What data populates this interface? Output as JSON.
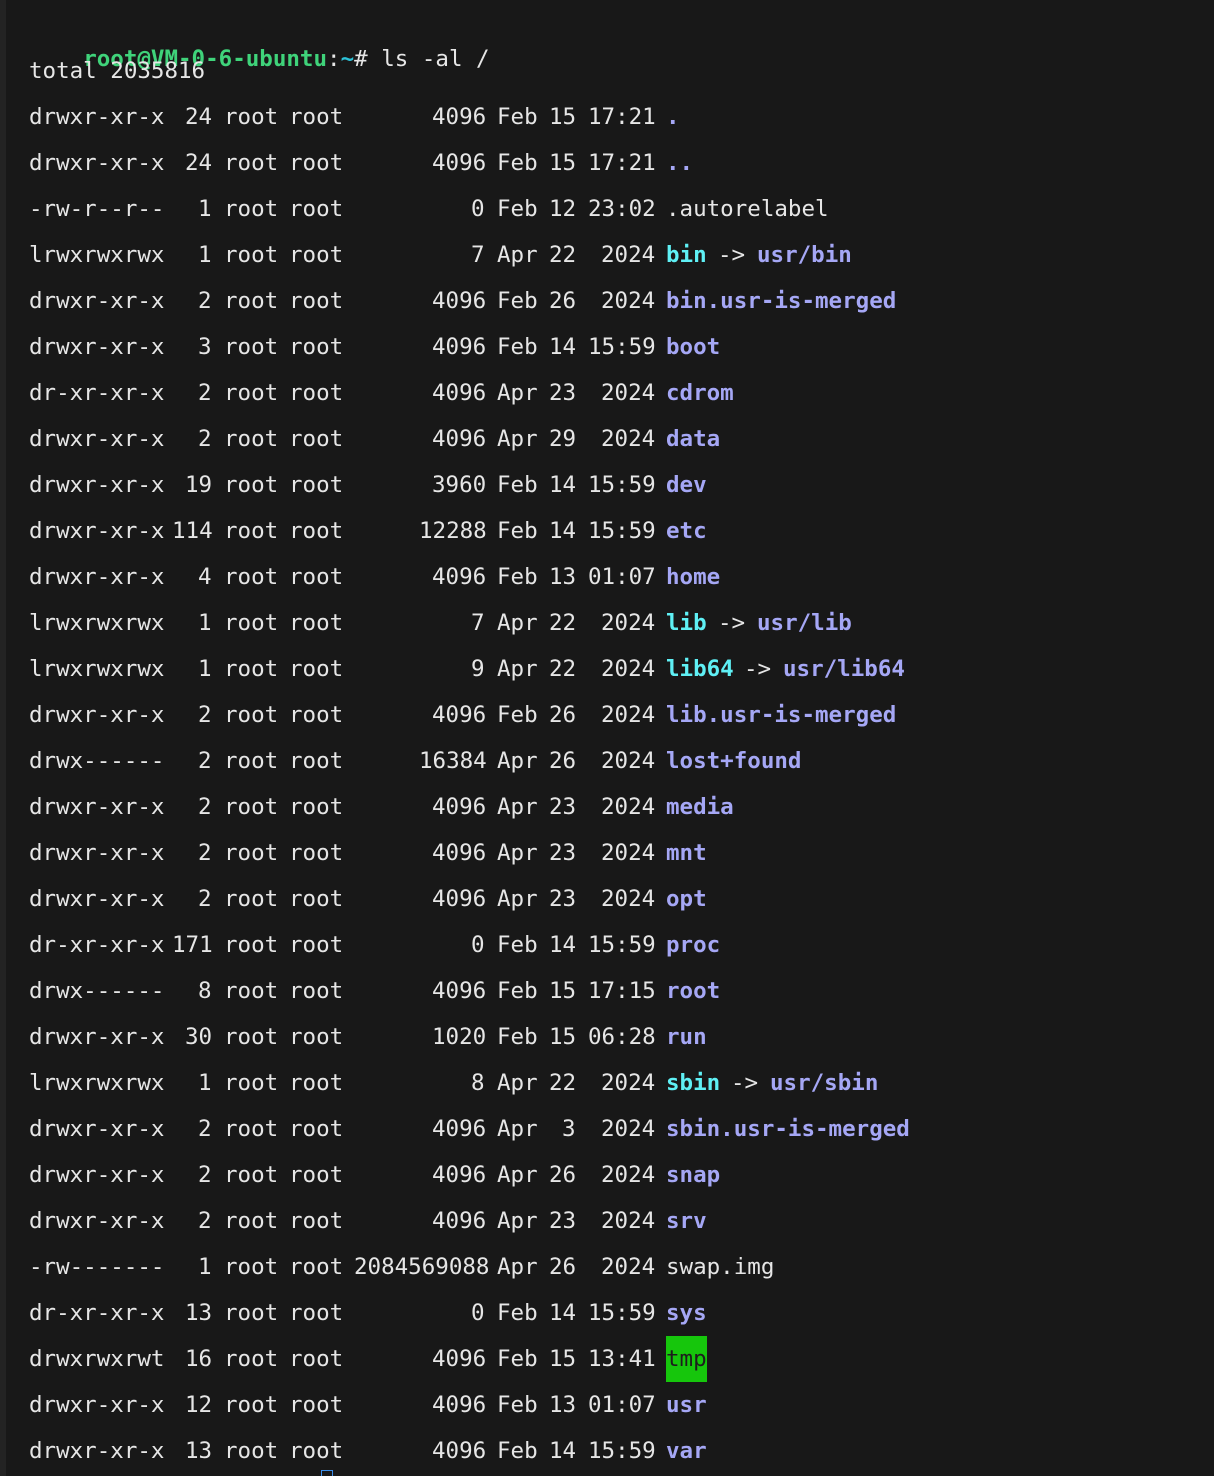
{
  "prompt": {
    "user_host": "root@VM-0-6-ubuntu",
    "colon": ":",
    "path": "~",
    "symbol": "#",
    "command": " ls -al /"
  },
  "total_line": "total 2035816",
  "colors": {
    "background": "#181818",
    "prompt_user": "#3fd37a",
    "prompt_path": "#2cc3d9",
    "directory": "#a5a7f5",
    "symlink": "#5ff0f5",
    "sticky_dir_bg": "#16c60c",
    "text": "#e6e6e6"
  },
  "entries": [
    {
      "perms": "drwxr-xr-x",
      "links": "24",
      "owner": "root",
      "group": "root",
      "size": "4096",
      "month": "Feb",
      "day": "15",
      "time": "17:21",
      "name": ".",
      "type": "dir"
    },
    {
      "perms": "drwxr-xr-x",
      "links": "24",
      "owner": "root",
      "group": "root",
      "size": "4096",
      "month": "Feb",
      "day": "15",
      "time": "17:21",
      "name": "..",
      "type": "dir"
    },
    {
      "perms": "-rw-r--r--",
      "links": "1",
      "owner": "root",
      "group": "root",
      "size": "0",
      "month": "Feb",
      "day": "12",
      "time": "23:02",
      "name": ".autorelabel",
      "type": "file"
    },
    {
      "perms": "lrwxrwxrwx",
      "links": "1",
      "owner": "root",
      "group": "root",
      "size": "7",
      "month": "Apr",
      "day": "22",
      "time": "2024",
      "name": "bin",
      "type": "link",
      "target": "usr/bin"
    },
    {
      "perms": "drwxr-xr-x",
      "links": "2",
      "owner": "root",
      "group": "root",
      "size": "4096",
      "month": "Feb",
      "day": "26",
      "time": "2024",
      "name": "bin.usr-is-merged",
      "type": "dir"
    },
    {
      "perms": "drwxr-xr-x",
      "links": "3",
      "owner": "root",
      "group": "root",
      "size": "4096",
      "month": "Feb",
      "day": "14",
      "time": "15:59",
      "name": "boot",
      "type": "dir"
    },
    {
      "perms": "dr-xr-xr-x",
      "links": "2",
      "owner": "root",
      "group": "root",
      "size": "4096",
      "month": "Apr",
      "day": "23",
      "time": "2024",
      "name": "cdrom",
      "type": "dir"
    },
    {
      "perms": "drwxr-xr-x",
      "links": "2",
      "owner": "root",
      "group": "root",
      "size": "4096",
      "month": "Apr",
      "day": "29",
      "time": "2024",
      "name": "data",
      "type": "dir"
    },
    {
      "perms": "drwxr-xr-x",
      "links": "19",
      "owner": "root",
      "group": "root",
      "size": "3960",
      "month": "Feb",
      "day": "14",
      "time": "15:59",
      "name": "dev",
      "type": "dir"
    },
    {
      "perms": "drwxr-xr-x",
      "links": "114",
      "owner": "root",
      "group": "root",
      "size": "12288",
      "month": "Feb",
      "day": "14",
      "time": "15:59",
      "name": "etc",
      "type": "dir"
    },
    {
      "perms": "drwxr-xr-x",
      "links": "4",
      "owner": "root",
      "group": "root",
      "size": "4096",
      "month": "Feb",
      "day": "13",
      "time": "01:07",
      "name": "home",
      "type": "dir"
    },
    {
      "perms": "lrwxrwxrwx",
      "links": "1",
      "owner": "root",
      "group": "root",
      "size": "7",
      "month": "Apr",
      "day": "22",
      "time": "2024",
      "name": "lib",
      "type": "link",
      "target": "usr/lib"
    },
    {
      "perms": "lrwxrwxrwx",
      "links": "1",
      "owner": "root",
      "group": "root",
      "size": "9",
      "month": "Apr",
      "day": "22",
      "time": "2024",
      "name": "lib64",
      "type": "link",
      "target": "usr/lib64"
    },
    {
      "perms": "drwxr-xr-x",
      "links": "2",
      "owner": "root",
      "group": "root",
      "size": "4096",
      "month": "Feb",
      "day": "26",
      "time": "2024",
      "name": "lib.usr-is-merged",
      "type": "dir"
    },
    {
      "perms": "drwx------",
      "links": "2",
      "owner": "root",
      "group": "root",
      "size": "16384",
      "month": "Apr",
      "day": "26",
      "time": "2024",
      "name": "lost+found",
      "type": "dir"
    },
    {
      "perms": "drwxr-xr-x",
      "links": "2",
      "owner": "root",
      "group": "root",
      "size": "4096",
      "month": "Apr",
      "day": "23",
      "time": "2024",
      "name": "media",
      "type": "dir"
    },
    {
      "perms": "drwxr-xr-x",
      "links": "2",
      "owner": "root",
      "group": "root",
      "size": "4096",
      "month": "Apr",
      "day": "23",
      "time": "2024",
      "name": "mnt",
      "type": "dir"
    },
    {
      "perms": "drwxr-xr-x",
      "links": "2",
      "owner": "root",
      "group": "root",
      "size": "4096",
      "month": "Apr",
      "day": "23",
      "time": "2024",
      "name": "opt",
      "type": "dir"
    },
    {
      "perms": "dr-xr-xr-x",
      "links": "171",
      "owner": "root",
      "group": "root",
      "size": "0",
      "month": "Feb",
      "day": "14",
      "time": "15:59",
      "name": "proc",
      "type": "dir"
    },
    {
      "perms": "drwx------",
      "links": "8",
      "owner": "root",
      "group": "root",
      "size": "4096",
      "month": "Feb",
      "day": "15",
      "time": "17:15",
      "name": "root",
      "type": "dir"
    },
    {
      "perms": "drwxr-xr-x",
      "links": "30",
      "owner": "root",
      "group": "root",
      "size": "1020",
      "month": "Feb",
      "day": "15",
      "time": "06:28",
      "name": "run",
      "type": "dir"
    },
    {
      "perms": "lrwxrwxrwx",
      "links": "1",
      "owner": "root",
      "group": "root",
      "size": "8",
      "month": "Apr",
      "day": "22",
      "time": "2024",
      "name": "sbin",
      "type": "link",
      "target": "usr/sbin"
    },
    {
      "perms": "drwxr-xr-x",
      "links": "2",
      "owner": "root",
      "group": "root",
      "size": "4096",
      "month": "Apr",
      "day": "3",
      "time": "2024",
      "name": "sbin.usr-is-merged",
      "type": "dir"
    },
    {
      "perms": "drwxr-xr-x",
      "links": "2",
      "owner": "root",
      "group": "root",
      "size": "4096",
      "month": "Apr",
      "day": "26",
      "time": "2024",
      "name": "snap",
      "type": "dir"
    },
    {
      "perms": "drwxr-xr-x",
      "links": "2",
      "owner": "root",
      "group": "root",
      "size": "4096",
      "month": "Apr",
      "day": "23",
      "time": "2024",
      "name": "srv",
      "type": "dir"
    },
    {
      "perms": "-rw-------",
      "links": "1",
      "owner": "root",
      "group": "root",
      "size": "2084569088",
      "month": "Apr",
      "day": "26",
      "time": "2024",
      "name": "swap.img",
      "type": "file"
    },
    {
      "perms": "dr-xr-xr-x",
      "links": "13",
      "owner": "root",
      "group": "root",
      "size": "0",
      "month": "Feb",
      "day": "14",
      "time": "15:59",
      "name": "sys",
      "type": "dir"
    },
    {
      "perms": "drwxrwxrwt",
      "links": "16",
      "owner": "root",
      "group": "root",
      "size": "4096",
      "month": "Feb",
      "day": "15",
      "time": "13:41",
      "name": "tmp",
      "type": "sticky"
    },
    {
      "perms": "drwxr-xr-x",
      "links": "12",
      "owner": "root",
      "group": "root",
      "size": "4096",
      "month": "Feb",
      "day": "13",
      "time": "01:07",
      "name": "usr",
      "type": "dir"
    },
    {
      "perms": "drwxr-xr-x",
      "links": "13",
      "owner": "root",
      "group": "root",
      "size": "4096",
      "month": "Feb",
      "day": "14",
      "time": "15:59",
      "name": "var",
      "type": "dir"
    }
  ]
}
